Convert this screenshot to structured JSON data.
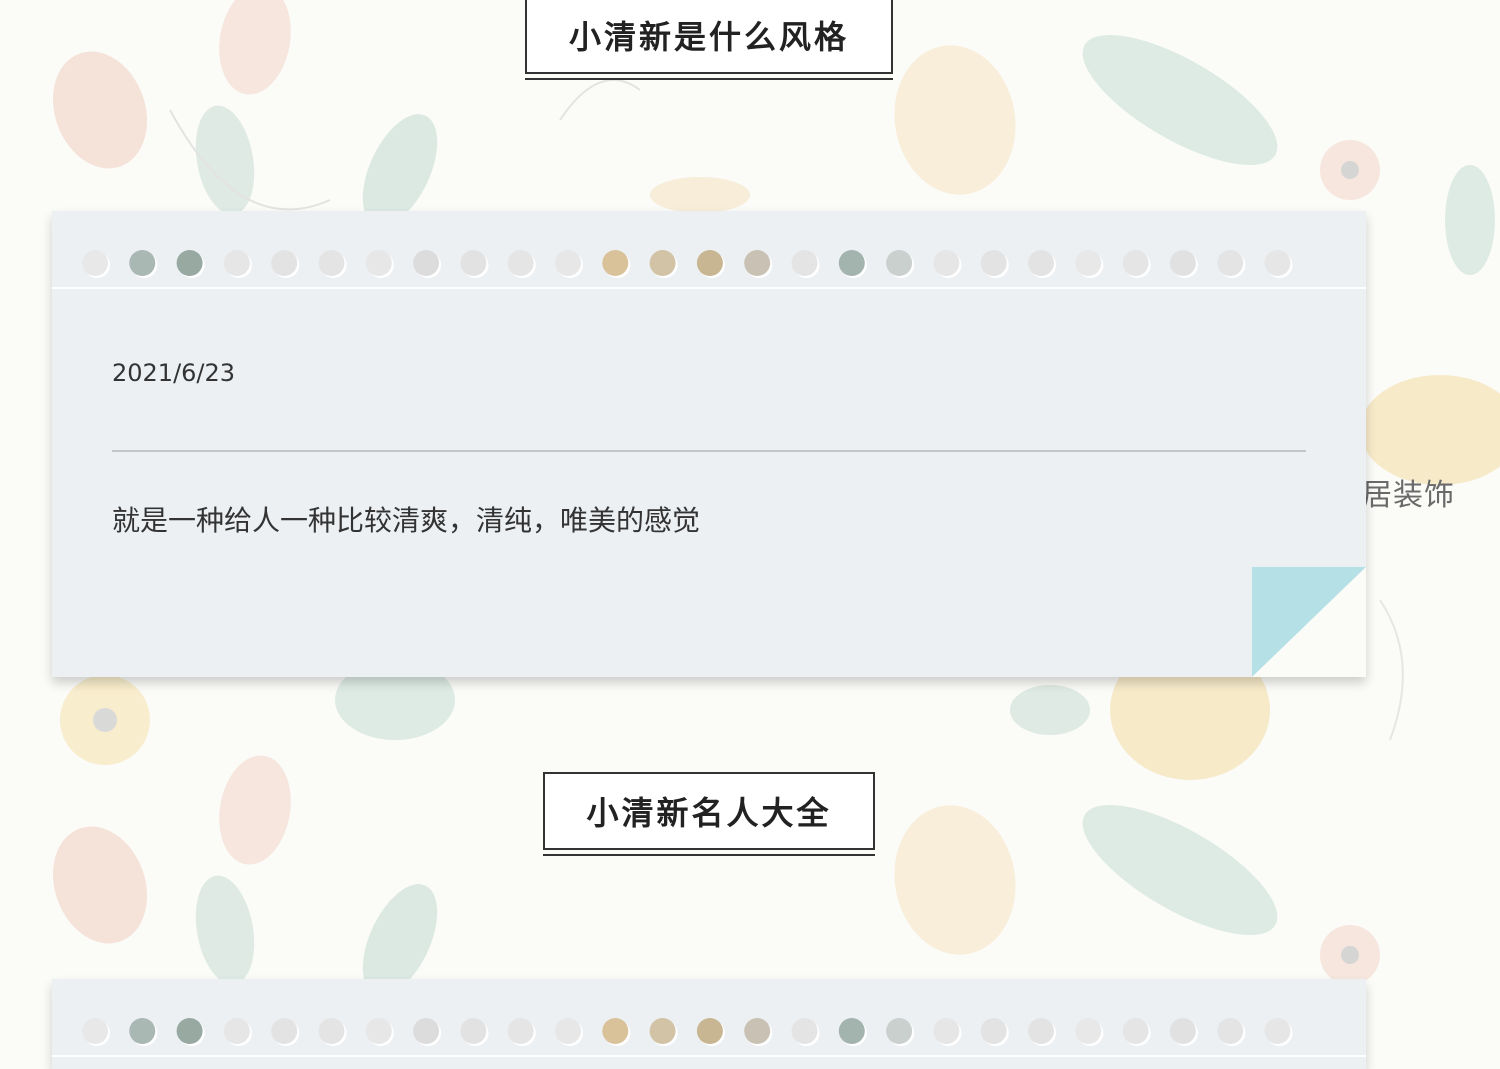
{
  "background": {
    "base_color": "#fbfbf8",
    "motif": "floral-watercolor-pattern",
    "edge_text": "居装饰"
  },
  "section1": {
    "title": "小清新是什么风格",
    "date": "2021/6/23",
    "description": "就是一种给人一种比较清爽，清纯，唯美的感觉"
  },
  "section2": {
    "title": "小清新名人大全"
  },
  "colors": {
    "card_bg": "#edf0f3",
    "corner_fold": "#b5e0e6",
    "hole_colors": [
      "#e8e8e8",
      "#a9b8b3",
      "#98a9a2",
      "#e6e6e6",
      "#e3e3e3",
      "#e4e4e4",
      "#e7e7e7",
      "#dcdcdc",
      "#e2e2e2",
      "#e5e5e5",
      "#e7e7e7",
      "#d9c29a",
      "#d2c3a6",
      "#c8b591",
      "#c9c2b4",
      "#e4e4e4",
      "#a3b3ad",
      "#c9d0cd",
      "#e6e6e6",
      "#e3e3e3",
      "#e3e3e3",
      "#e8e8e8",
      "#e5e5e5",
      "#e1e1e1",
      "#e4e4e4",
      "#e6e6e6"
    ]
  }
}
